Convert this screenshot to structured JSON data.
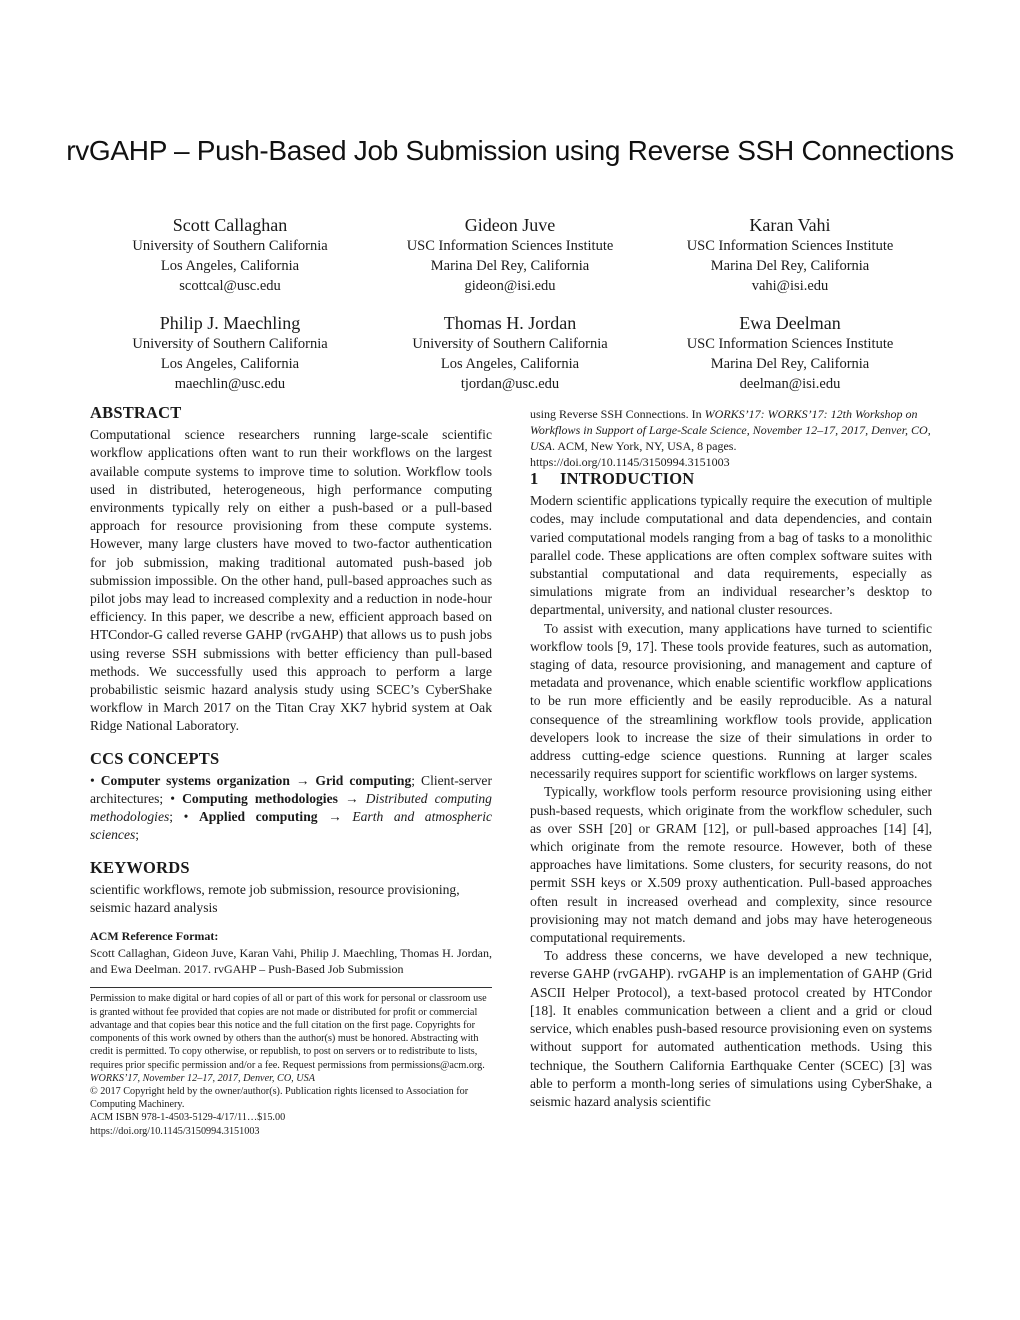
{
  "title": "rvGAHP – Push-Based Job Submission using Reverse SSH Connections",
  "authors": [
    {
      "name": "Scott Callaghan",
      "affiliation": "University of Southern California",
      "location": "Los Angeles, California",
      "email": "scottcal@usc.edu"
    },
    {
      "name": "Gideon Juve",
      "affiliation": "USC Information Sciences Institute",
      "location": "Marina Del Rey, California",
      "email": "gideon@isi.edu"
    },
    {
      "name": "Karan Vahi",
      "affiliation": "USC Information Sciences Institute",
      "location": "Marina Del Rey, California",
      "email": "vahi@isi.edu"
    },
    {
      "name": "Philip J. Maechling",
      "affiliation": "University of Southern California",
      "location": "Los Angeles, California",
      "email": "maechlin@usc.edu"
    },
    {
      "name": "Thomas H. Jordan",
      "affiliation": "University of Southern California",
      "location": "Los Angeles, California",
      "email": "tjordan@usc.edu"
    },
    {
      "name": "Ewa Deelman",
      "affiliation": "USC Information Sciences Institute",
      "location": "Marina Del Rey, California",
      "email": "deelman@isi.edu"
    }
  ],
  "abstract": {
    "heading": "ABSTRACT",
    "text": "Computational science researchers running large-scale scientific workflow applications often want to run their workflows on the largest available compute systems to improve time to solution. Workflow tools used in distributed, heterogeneous, high performance computing environments typically rely on either a push-based or a pull-based approach for resource provisioning from these compute systems. However, many large clusters have moved to two-factor authentication for job submission, making traditional automated push-based job submission impossible. On the other hand, pull-based approaches such as pilot jobs may lead to increased complexity and a reduction in node-hour efficiency. In this paper, we describe a new, efficient approach based on HTCondor-G called reverse GAHP (rvGAHP) that allows us to push jobs using reverse SSH submissions with better efficiency than pull-based methods. We successfully used this approach to perform a large probabilistic seismic hazard analysis study using SCEC’s CyberShake workflow in March 2017 on the Titan Cray XK7 hybrid system at Oak Ridge National Laboratory."
  },
  "ccs": {
    "heading": "CCS CONCEPTS",
    "bullet": "•",
    "arrow": "→",
    "c1_bold": "Computer systems organization",
    "c1_target": "Grid computing",
    "c1_rest": "; Client-server architectures; ",
    "c2_bold": "Computing methodologies",
    "c2_target": "Distributed computing methodologies",
    "c2_rest": "; ",
    "c3_bold": "Applied computing",
    "c3_target": "Earth and atmospheric sciences",
    "c3_rest": ";"
  },
  "keywords": {
    "heading": "KEYWORDS",
    "text": "scientific workflows, remote job submission, resource provisioning, seismic hazard analysis"
  },
  "acm_reference": {
    "label": "ACM Reference Format:",
    "text_start": "Scott Callaghan, Gideon Juve, Karan Vahi, Philip J. Maechling, Thomas H. Jordan, and Ewa Deelman. 2017. rvGAHP – Push-Based Job Submission",
    "text_cont_plain": "using Reverse SSH Connections. In ",
    "text_cont_italic": "WORKS’17: WORKS’17: 12th Workshop on Workflows in Support of Large-Scale Science, November 12–17, 2017, Denver, CO, USA",
    "text_cont_end": ". ACM, New York, NY, USA, 8 pages. https://doi.org/10.1145/3150994.3151003"
  },
  "permission": {
    "text": "Permission to make digital or hard copies of all or part of this work for personal or classroom use is granted without fee provided that copies are not made or distributed for profit or commercial advantage and that copies bear this notice and the full citation on the first page. Copyrights for components of this work owned by others than the author(s) must be honored. Abstracting with credit is permitted. To copy otherwise, or republish, to post on servers or to redistribute to lists, requires prior specific permission and/or a fee. Request permissions from permissions@acm.org.",
    "venue": "WORKS’17, November 12–17, 2017, Denver, CO, USA",
    "copyright": "© 2017 Copyright held by the owner/author(s). Publication rights licensed to Association for Computing Machinery.",
    "isbn": "ACM ISBN 978-1-4503-5129-4/17/11…$15.00",
    "doi": "https://doi.org/10.1145/3150994.3151003"
  },
  "introduction": {
    "number": "1",
    "heading": "INTRODUCTION",
    "paragraphs": [
      "Modern scientific applications typically require the execution of multiple codes, may include computational and data dependencies, and contain varied computational models ranging from a bag of tasks to a monolithic parallel code. These applications are often complex software suites with substantial computational and data requirements, especially as simulations migrate from an individual researcher’s desktop to departmental, university, and national cluster resources.",
      "To assist with execution, many applications have turned to scientific workflow tools [9, 17]. These tools provide features, such as automation, staging of data, resource provisioning, and management and capture of metadata and provenance, which enable scientific workflow applications to be run more efficiently and be easily reproducible. As a natural consequence of the streamlining workflow tools provide, application developers look to increase the size of their simulations in order to address cutting-edge science questions. Running at larger scales necessarily requires support for scientific workflows on larger systems.",
      "Typically, workflow tools perform resource provisioning using either push-based requests, which originate from the workflow scheduler, such as over SSH [20] or GRAM [12], or pull-based approaches [14] [4], which originate from the remote resource. However, both of these approaches have limitations. Some clusters, for security reasons, do not permit SSH keys or X.509 proxy authentication. Pull-based approaches often result in increased overhead and complexity, since resource provisioning may not match demand and jobs may have heterogeneous computational requirements.",
      "To address these concerns, we have developed a new technique, reverse GAHP (rvGAHP). rvGAHP is an implementation of GAHP (Grid ASCII Helper Protocol), a text-based protocol created by HTCondor [18]. It enables communication between a client and a grid or cloud service, which enables push-based resource provisioning even on systems without support for automated authentication methods. Using this technique, the Southern California Earthquake Center (SCEC) [3] was able to perform a month-long series of simulations using CyberShake, a seismic hazard analysis scientific"
    ]
  }
}
